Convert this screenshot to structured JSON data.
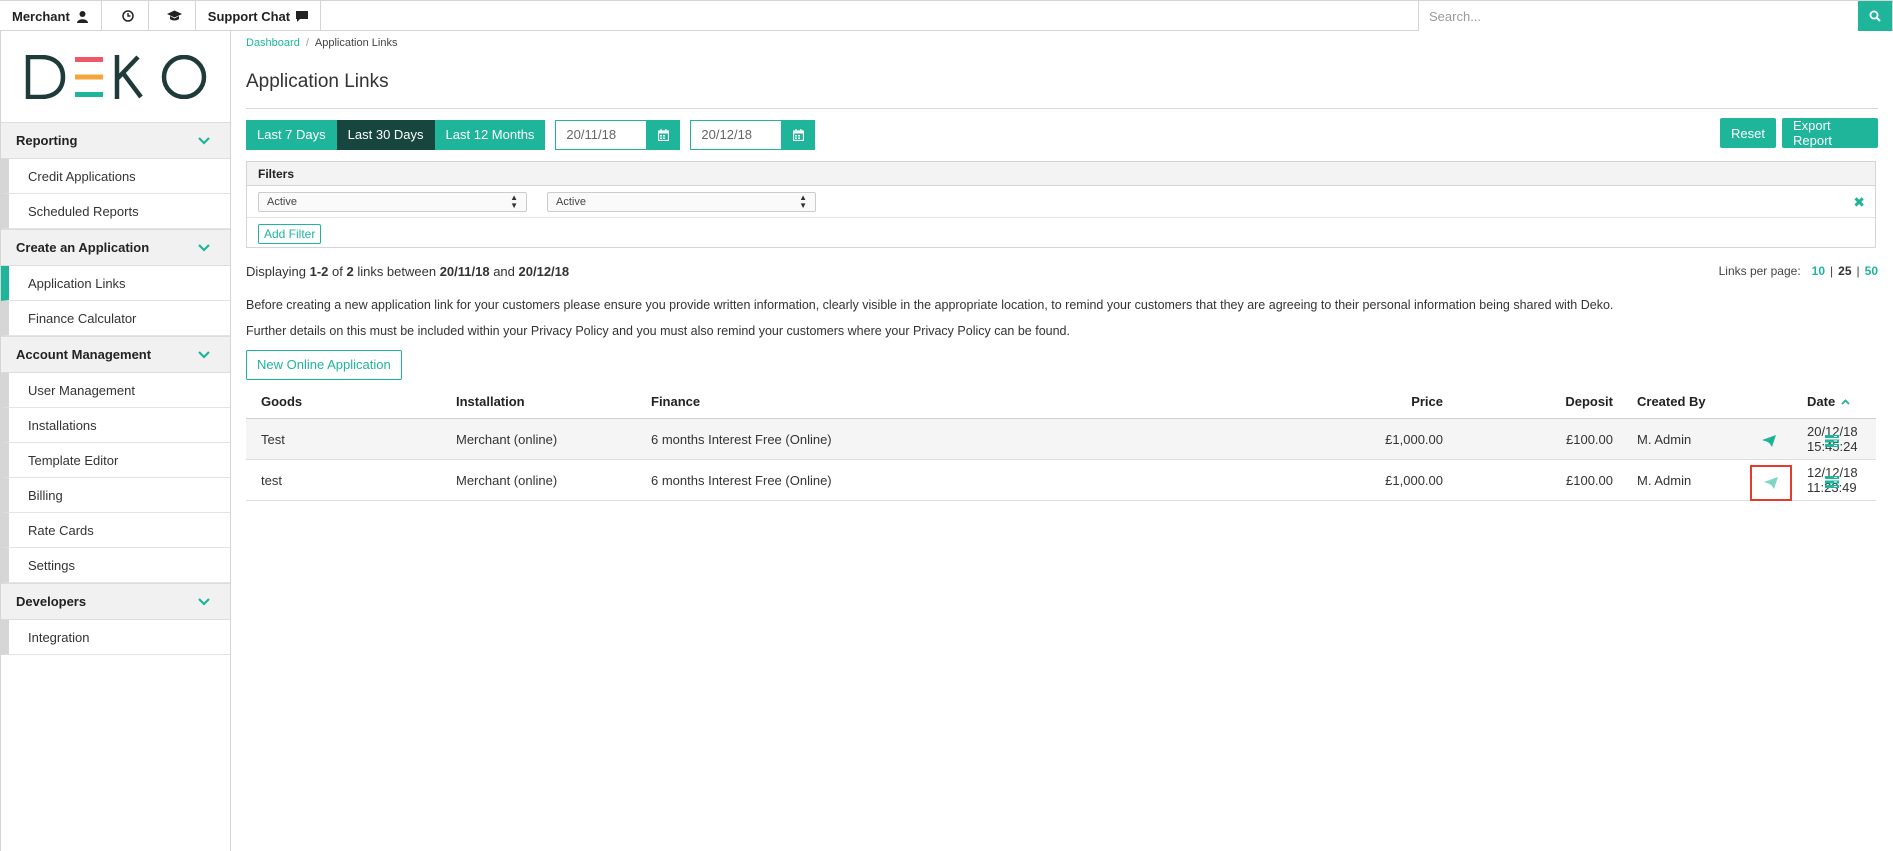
{
  "topbar": {
    "merchant_label": "Merchant",
    "support_label": "Support Chat",
    "search_placeholder": "Search..."
  },
  "logo": {
    "text": "DEKO",
    "colors": [
      "#f0566a",
      "#f6a53a",
      "#1fb59a"
    ]
  },
  "sidebar": {
    "sections": [
      {
        "label": "Reporting",
        "items": [
          "Credit Applications",
          "Scheduled Reports"
        ]
      },
      {
        "label": "Create an Application",
        "items": [
          "Application Links",
          "Finance Calculator"
        ]
      },
      {
        "label": "Account Management",
        "items": [
          "User Management",
          "Installations",
          "Template Editor",
          "Billing",
          "Rate Cards",
          "Settings"
        ]
      },
      {
        "label": "Developers",
        "items": [
          "Integration"
        ]
      }
    ],
    "active_item": "Application Links"
  },
  "breadcrumb": {
    "home": "Dashboard",
    "separator": "/",
    "current": "Application Links"
  },
  "page_title": "Application Links",
  "range_buttons": [
    "Last 7 Days",
    "Last 30 Days",
    "Last 12 Months"
  ],
  "active_range": "Last 30 Days",
  "date_from": "20/11/18",
  "date_to": "20/12/18",
  "reset_label": "Reset",
  "export_label": "Export Report",
  "filters": {
    "heading": "Filters",
    "select1": "Active",
    "select2": "Active",
    "add_label": "Add Filter"
  },
  "display": {
    "prefix": "Displaying ",
    "range": "1-2",
    "of": " of ",
    "total": "2",
    "between": " links between ",
    "from": "20/11/18",
    "and": " and ",
    "to": "20/12/18"
  },
  "per_page": {
    "label": "Links per page:",
    "options": [
      "10",
      "25",
      "50"
    ],
    "current": "25"
  },
  "info_line1": "Before creating a new application link for your customers please ensure you provide written information, clearly visible in the appropriate location, to remind your customers that they are agreeing to their personal information being shared with Deko.",
  "info_line2": "Further details on this must be included within your Privacy Policy and you must also remind your customers where your Privacy Policy can be found.",
  "new_app_label": "New Online Application",
  "table": {
    "headers": {
      "goods": "Goods",
      "installation": "Installation",
      "finance": "Finance",
      "price": "Price",
      "deposit": "Deposit",
      "created_by": "Created By",
      "date": "Date"
    },
    "rows": [
      {
        "goods": "Test",
        "installation": "Merchant (online)",
        "finance": "6 months Interest Free (Online)",
        "price": "£1,000.00",
        "deposit": "£100.00",
        "created_by": "M. Admin",
        "date": "20/12/18 15:45:24"
      },
      {
        "goods": "test",
        "installation": "Merchant (online)",
        "finance": "6 months Interest Free (Online)",
        "price": "£1,000.00",
        "deposit": "£100.00",
        "created_by": "M. Admin",
        "date": "12/12/18 11:23:49"
      }
    ]
  },
  "colors": {
    "accent": "#1fb59a",
    "active_range": "#17463f",
    "highlight": "#e53b2c"
  }
}
